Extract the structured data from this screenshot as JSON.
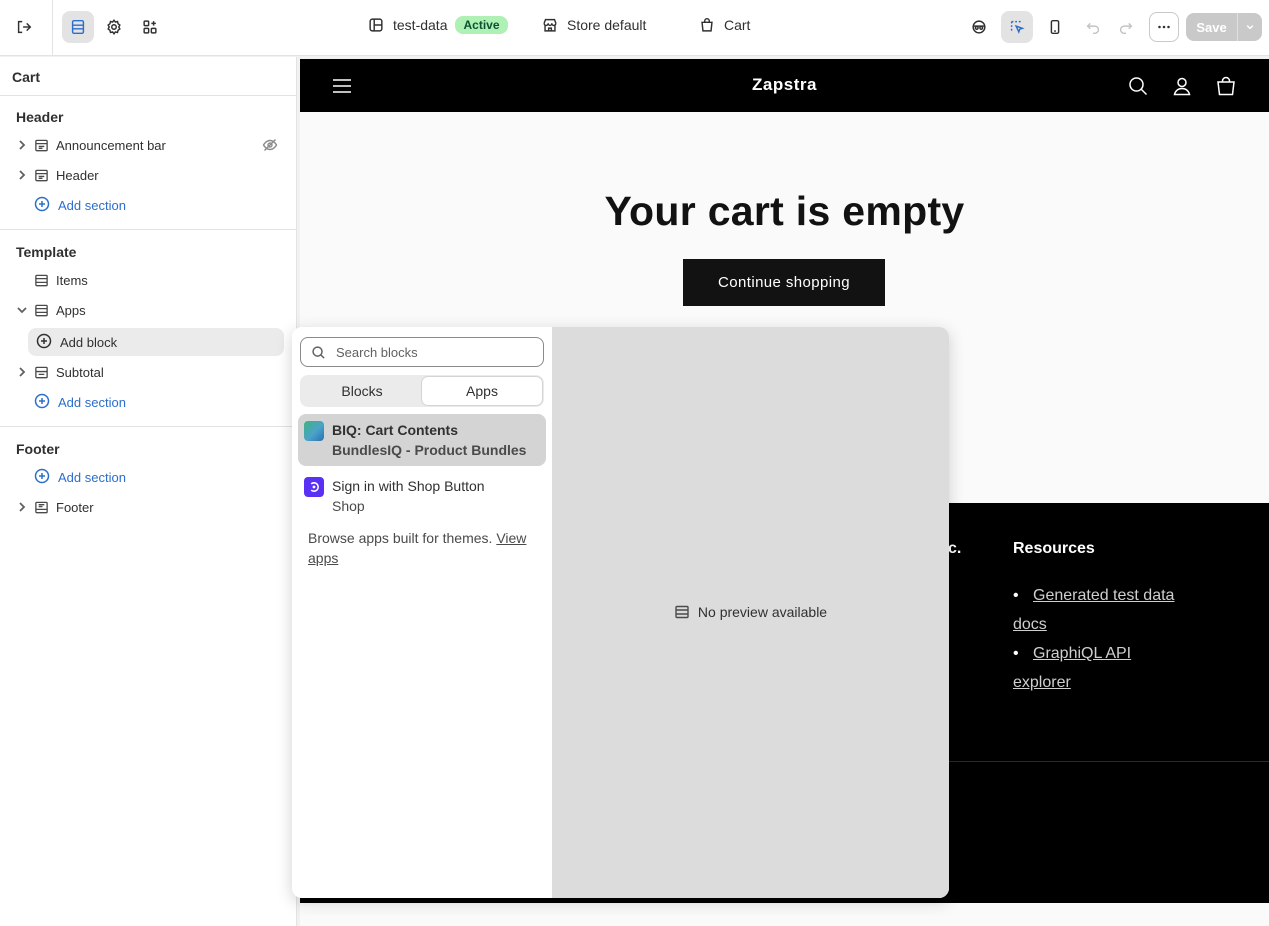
{
  "topbar": {
    "theme_name": "test-data",
    "theme_status": "Active",
    "store_label": "Store default",
    "page_label": "Cart",
    "save_label": "Save"
  },
  "sidebar": {
    "title": "Cart",
    "groups": {
      "header": {
        "title": "Header",
        "items": [
          "Announcement bar",
          "Header"
        ],
        "add_label": "Add section"
      },
      "template": {
        "title": "Template",
        "items": [
          "Items",
          "Apps",
          "Subtotal"
        ],
        "add_block_label": "Add block",
        "add_label": "Add section"
      },
      "footer": {
        "title": "Footer",
        "add_label": "Add section",
        "items": [
          "Footer"
        ]
      }
    }
  },
  "preview": {
    "brand": "Zapstra",
    "heading": "Your cart is empty",
    "continue_label": "Continue shopping",
    "footer_partial": "c.",
    "footer_resources_title": "Resources",
    "footer_links": [
      "Generated test data",
      "docs",
      "GraphiQL API",
      "explorer"
    ]
  },
  "picker": {
    "search_placeholder": "Search blocks",
    "tabs": [
      "Blocks",
      "Apps"
    ],
    "active_tab": "Apps",
    "apps": [
      {
        "title": "BIQ: Cart Contents",
        "subtitle": "BundlesIQ - Product Bundles",
        "logo_color": "#4aa3c9"
      },
      {
        "title": "Sign in with Shop Button",
        "subtitle": "Shop",
        "logo_color": "#5a31f4"
      }
    ],
    "browse_text": "Browse apps built for themes.",
    "browse_link_1": "View",
    "browse_link_2": "apps",
    "no_preview": "No preview available"
  },
  "colors": {
    "accent": "#2c6ecb",
    "active_badge": "#aff0b5"
  }
}
